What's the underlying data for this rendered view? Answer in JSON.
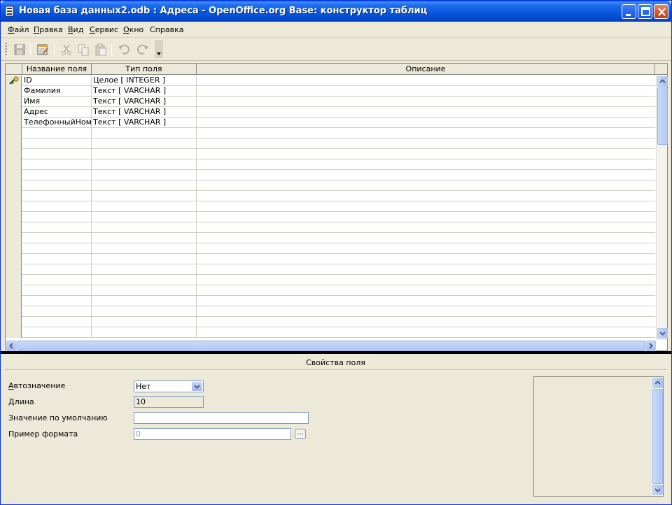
{
  "window": {
    "title": "Новая база данных2.odb : Адреса - OpenOffice.org Base: конструктор таблиц"
  },
  "menu": {
    "items": [
      {
        "first": "Ф",
        "rest": "айл"
      },
      {
        "first": "П",
        "rest": "равка"
      },
      {
        "first": "В",
        "rest": "ид"
      },
      {
        "first": "С",
        "rest": "ервис"
      },
      {
        "first": "О",
        "rest": "кно"
      },
      {
        "first": "Спр",
        "rest": "авка",
        "acc": "a"
      }
    ]
  },
  "toolbar": {
    "icons": [
      "save-icon",
      "edit-index-icon",
      "cut-icon",
      "copy-icon",
      "paste-icon",
      "undo-icon",
      "redo-icon",
      "toolbar-overflow-icon"
    ]
  },
  "grid": {
    "headers": {
      "name": "Название поля",
      "type": "Тип поля",
      "description": "Описание"
    },
    "rows": [
      {
        "name": "ID",
        "type": "Целое [ INTEGER ]",
        "description": "",
        "primary_key": true
      },
      {
        "name": "Фамилия",
        "type": "Текст [ VARCHAR ]",
        "description": ""
      },
      {
        "name": "Имя",
        "type": "Текст [ VARCHAR ]",
        "description": ""
      },
      {
        "name": "Адрес",
        "type": "Текст [ VARCHAR ]",
        "description": ""
      },
      {
        "name": "ТелефонныйНомер",
        "type": "Текст [ VARCHAR ]",
        "description": ""
      }
    ]
  },
  "properties": {
    "title": "Свойства поля",
    "autovalue": {
      "label_acc": "А",
      "label_rest": "втозначение",
      "value": "Нет"
    },
    "length": {
      "label": "Длина",
      "value": "10"
    },
    "default_value": {
      "label": "Значение по умолчанию",
      "value": ""
    },
    "format_example": {
      "label": "Пример формата",
      "value": "0",
      "button": "..."
    }
  },
  "colors": {
    "titlebar": "#0a56d8",
    "window_bg": "#ece9d8",
    "scroll_accent": "#b1c8f5"
  }
}
